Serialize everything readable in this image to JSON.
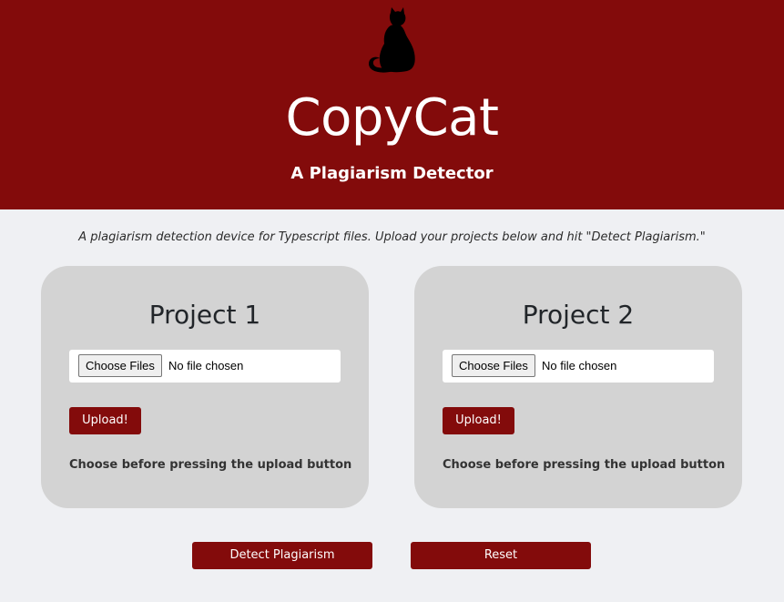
{
  "header": {
    "logo_icon": "cat-silhouette-icon",
    "title": "CopyCat",
    "subtitle": "A Plagiarism Detector"
  },
  "intro": "A plagiarism detection device for Typescript files. Upload your projects below and hit \"Detect Plagiarism.\"",
  "projects": [
    {
      "title": "Project 1",
      "choose_label": "Choose Files",
      "file_status": "No file chosen",
      "upload_label": "Upload!",
      "hint": "Choose before pressing the upload button"
    },
    {
      "title": "Project 2",
      "choose_label": "Choose Files",
      "file_status": "No file chosen",
      "upload_label": "Upload!",
      "hint": "Choose before pressing the upload button"
    }
  ],
  "actions": {
    "detect_label": "Detect Plagiarism",
    "reset_label": "Reset"
  },
  "colors": {
    "brand": "#830b0b",
    "background": "#eff0f3",
    "card": "#d3d3d3"
  }
}
